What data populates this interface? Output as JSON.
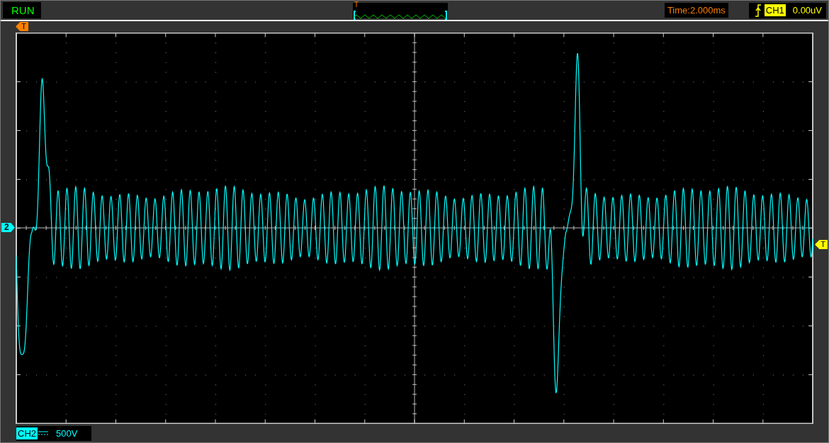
{
  "status": {
    "text": "RUN"
  },
  "overview": {
    "trigger_mark": "T"
  },
  "timebase": {
    "text": "Time:2.000ms"
  },
  "trigger": {
    "channel": "CH1",
    "level": "0.00uV"
  },
  "markers": {
    "trigger_position": "T",
    "channel": "2",
    "trigger_level": "T"
  },
  "channel": {
    "name": "CH2",
    "scale": "500V"
  }
}
